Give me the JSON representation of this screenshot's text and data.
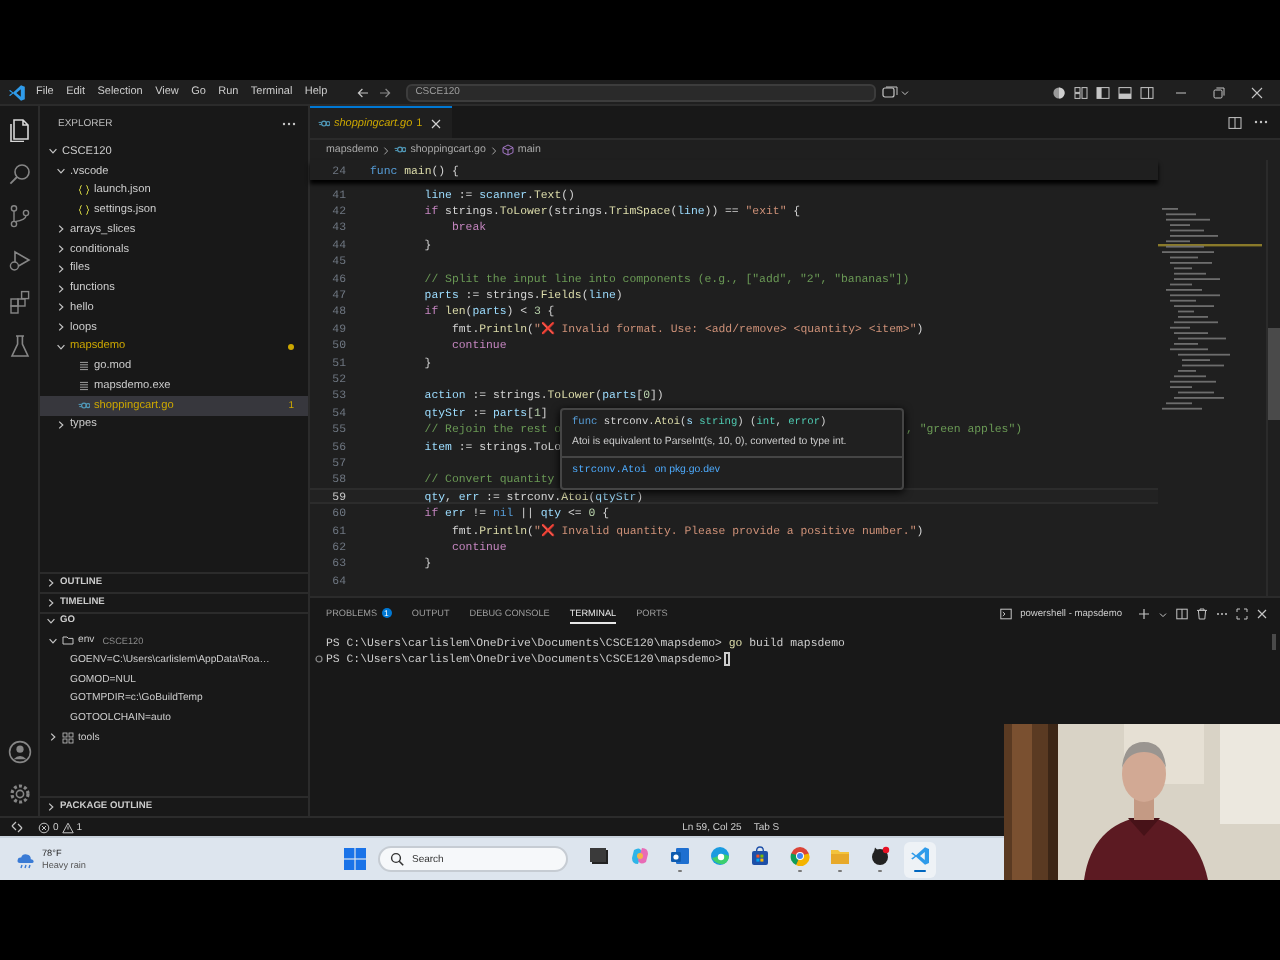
{
  "title_bar": {
    "menu": [
      "File",
      "Edit",
      "Selection",
      "View",
      "Go",
      "Run",
      "Terminal",
      "Help"
    ],
    "search": "CSCE120"
  },
  "activity_bar": [
    {
      "kind": "files",
      "selected": true
    },
    {
      "kind": "search",
      "selected": false
    },
    {
      "kind": "scm",
      "selected": false
    },
    {
      "kind": "debug",
      "selected": false
    },
    {
      "kind": "extensions",
      "selected": false
    },
    {
      "kind": "testing",
      "selected": false
    },
    {
      "kind": "account",
      "selected": false
    },
    {
      "kind": "settings",
      "selected": false
    }
  ],
  "sidebar": {
    "title": "EXPLORER",
    "tree": [
      {
        "label": "CSCE120",
        "kind": "folder",
        "expanded": true,
        "selected": false,
        "warning": false,
        "children": [
          {
            "label": ".vscode",
            "kind": "folder",
            "expanded": true,
            "selected": false,
            "warning": false,
            "children": [
              {
                "label": "launch.json",
                "kind": "json",
                "selected": false,
                "warning": false
              },
              {
                "label": "settings.json",
                "kind": "json",
                "selected": false,
                "warning": false
              }
            ]
          },
          {
            "label": "arrays_slices",
            "kind": "folder",
            "expanded": false,
            "selected": false,
            "warning": false
          },
          {
            "label": "conditionals",
            "kind": "folder",
            "expanded": false,
            "selected": false,
            "warning": false
          },
          {
            "label": "files",
            "kind": "folder",
            "expanded": false,
            "selected": false,
            "warning": false
          },
          {
            "label": "functions",
            "kind": "folder",
            "expanded": false,
            "selected": false,
            "warning": false
          },
          {
            "label": "hello",
            "kind": "folder",
            "expanded": false,
            "selected": false,
            "warning": false
          },
          {
            "label": "loops",
            "kind": "folder",
            "expanded": false,
            "selected": false,
            "warning": false
          },
          {
            "label": "mapsdemo",
            "kind": "folder",
            "expanded": true,
            "selected": false,
            "warning": true,
            "children": [
              {
                "label": "go.mod",
                "kind": "file",
                "selected": false,
                "warning": false
              },
              {
                "label": "mapsdemo.exe",
                "kind": "file",
                "selected": false,
                "warning": false
              },
              {
                "label": "shoppingcart.go",
                "kind": "go",
                "selected": true,
                "warning": true,
                "badge": "1"
              }
            ]
          },
          {
            "label": "types",
            "kind": "folder",
            "expanded": false,
            "selected": false,
            "warning": false
          }
        ]
      }
    ],
    "sections": [
      {
        "label": "OUTLINE",
        "expanded": false
      },
      {
        "label": "TIMELINE",
        "expanded": false
      },
      {
        "label": "GO",
        "expanded": true,
        "tree": [
          {
            "label": "env",
            "detail": "CSCE120",
            "kind": "folder",
            "expanded": true,
            "children": [
              {
                "label": "GOENV=C:\\Users\\carlislem\\AppData\\Roa…"
              },
              {
                "label": "GOMOD=NUL"
              },
              {
                "label": "GOTMPDIR=c:\\GoBuildTemp"
              },
              {
                "label": "GOTOOLCHAIN=auto"
              }
            ]
          },
          {
            "label": "tools",
            "kind": "tools",
            "expanded": false
          }
        ]
      },
      {
        "label": "PACKAGE OUTLINE",
        "expanded": false
      }
    ]
  },
  "editor": {
    "tabs": [
      {
        "label": "shoppingcart.go",
        "badge": "1",
        "selected": true,
        "warning": true
      }
    ],
    "breadcrumbs": [
      {
        "label": "mapsdemo",
        "kind": "folder"
      },
      {
        "label": "shoppingcart.go",
        "kind": "go"
      },
      {
        "label": "main",
        "kind": "function"
      }
    ],
    "sticky": {
      "n": "24",
      "code": [
        {
          "kind": "keyword",
          "text": "func "
        },
        {
          "kind": "function",
          "text": "main"
        },
        {
          "kind": "plain",
          "text": "() {"
        }
      ]
    },
    "lines": [
      {
        "n": "41",
        "current": false,
        "code": [
          {
            "kind": "variable",
            "text": "        line"
          },
          {
            "kind": "plain",
            "text": " := "
          },
          {
            "kind": "variable",
            "text": "scanner"
          },
          {
            "kind": "plain",
            "text": "."
          },
          {
            "kind": "function",
            "text": "Text"
          },
          {
            "kind": "plain",
            "text": "()"
          }
        ]
      },
      {
        "n": "42",
        "current": false,
        "code": [
          {
            "kind": "control",
            "text": "        if"
          },
          {
            "kind": "plain",
            "text": " strings."
          },
          {
            "kind": "function",
            "text": "ToLower"
          },
          {
            "kind": "plain",
            "text": "(strings."
          },
          {
            "kind": "function",
            "text": "TrimSpace"
          },
          {
            "kind": "plain",
            "text": "("
          },
          {
            "kind": "variable",
            "text": "line"
          },
          {
            "kind": "plain",
            "text": ")) == "
          },
          {
            "kind": "string",
            "text": "\"exit\""
          },
          {
            "kind": "plain",
            "text": " {"
          }
        ]
      },
      {
        "n": "43",
        "current": false,
        "code": [
          {
            "kind": "control",
            "text": "            break"
          }
        ]
      },
      {
        "n": "44",
        "current": false,
        "code": [
          {
            "kind": "plain",
            "text": "        }"
          }
        ]
      },
      {
        "n": "45",
        "current": false
      },
      {
        "n": "46",
        "current": false,
        "code": [
          {
            "kind": "comment",
            "text": "        // Split the input line into components (e.g., [\"add\", \"2\", \"bananas\"])"
          }
        ]
      },
      {
        "n": "47",
        "current": false,
        "code": [
          {
            "kind": "variable",
            "text": "        parts"
          },
          {
            "kind": "plain",
            "text": " := strings."
          },
          {
            "kind": "function",
            "text": "Fields"
          },
          {
            "kind": "plain",
            "text": "("
          },
          {
            "kind": "variable",
            "text": "line"
          },
          {
            "kind": "plain",
            "text": ")"
          }
        ]
      },
      {
        "n": "48",
        "current": false,
        "code": [
          {
            "kind": "control",
            "text": "        if "
          },
          {
            "kind": "function",
            "text": "len"
          },
          {
            "kind": "plain",
            "text": "("
          },
          {
            "kind": "variable",
            "text": "parts"
          },
          {
            "kind": "plain",
            "text": ") < "
          },
          {
            "kind": "number",
            "text": "3"
          },
          {
            "kind": "plain",
            "text": " {"
          }
        ]
      },
      {
        "n": "49",
        "current": false,
        "code": [
          {
            "kind": "plain",
            "text": "            fmt."
          },
          {
            "kind": "function",
            "text": "Println"
          },
          {
            "kind": "plain",
            "text": "("
          },
          {
            "kind": "string",
            "text": "\"❌ Invalid format. Use: <add/remove> <quantity> <item>\""
          },
          {
            "kind": "plain",
            "text": ")"
          }
        ]
      },
      {
        "n": "50",
        "current": false,
        "code": [
          {
            "kind": "control",
            "text": "            continue"
          }
        ]
      },
      {
        "n": "51",
        "current": false,
        "code": [
          {
            "kind": "plain",
            "text": "        }"
          }
        ]
      },
      {
        "n": "52",
        "current": false
      },
      {
        "n": "53",
        "current": false,
        "code": [
          {
            "kind": "variable",
            "text": "        action"
          },
          {
            "kind": "plain",
            "text": " := strings."
          },
          {
            "kind": "function",
            "text": "ToLower"
          },
          {
            "kind": "plain",
            "text": "("
          },
          {
            "kind": "variable",
            "text": "parts"
          },
          {
            "kind": "plain",
            "text": "["
          },
          {
            "kind": "number",
            "text": "0"
          },
          {
            "kind": "plain",
            "text": "])"
          }
        ]
      },
      {
        "n": "54",
        "current": false,
        "code": [
          {
            "kind": "variable",
            "text": "        qtyStr"
          },
          {
            "kind": "plain",
            "text": " := "
          },
          {
            "kind": "variable",
            "text": "parts"
          },
          {
            "kind": "plain",
            "text": "["
          },
          {
            "kind": "number",
            "text": "1"
          },
          {
            "kind": "plain",
            "text": "]"
          }
        ]
      },
      {
        "n": "55",
        "current": false,
        "code": [
          {
            "kind": "comment",
            "text": "        // Rejoin the rest o"
          }
        ],
        "tail": [
          {
            "kind": "comment",
            "text": ", \"green apples\")"
          }
        ]
      },
      {
        "n": "56",
        "current": false,
        "code": [
          {
            "kind": "variable",
            "text": "        item"
          },
          {
            "kind": "plain",
            "text": " := strings.ToLo"
          }
        ]
      },
      {
        "n": "57",
        "current": false
      },
      {
        "n": "58",
        "current": false,
        "code": [
          {
            "kind": "comment",
            "text": "        // Convert quantity"
          }
        ]
      },
      {
        "n": "59",
        "current": true,
        "code": [
          {
            "kind": "variable",
            "text": "        qty"
          },
          {
            "kind": "plain",
            "text": ", "
          },
          {
            "kind": "variable",
            "text": "err"
          },
          {
            "kind": "plain",
            "text": " := strconv."
          },
          {
            "kind": "function",
            "text": "Atoi"
          },
          {
            "kind": "plain",
            "text": "("
          },
          {
            "kind": "variable",
            "text": "qtyStr"
          },
          {
            "kind": "plain",
            "text": ")"
          }
        ]
      },
      {
        "n": "60",
        "current": false,
        "code": [
          {
            "kind": "control",
            "text": "        if "
          },
          {
            "kind": "variable",
            "text": "err"
          },
          {
            "kind": "plain",
            "text": " != "
          },
          {
            "kind": "keyword",
            "text": "nil"
          },
          {
            "kind": "plain",
            "text": " || "
          },
          {
            "kind": "variable",
            "text": "qty"
          },
          {
            "kind": "plain",
            "text": " <= "
          },
          {
            "kind": "number",
            "text": "0"
          },
          {
            "kind": "plain",
            "text": " {"
          }
        ]
      },
      {
        "n": "61",
        "current": false,
        "code": [
          {
            "kind": "plain",
            "text": "            fmt."
          },
          {
            "kind": "function",
            "text": "Println"
          },
          {
            "kind": "plain",
            "text": "("
          },
          {
            "kind": "string",
            "text": "\"❌ Invalid quantity. Please provide a positive number.\""
          },
          {
            "kind": "plain",
            "text": ")"
          }
        ]
      },
      {
        "n": "62",
        "current": false,
        "code": [
          {
            "kind": "control",
            "text": "            continue"
          }
        ]
      },
      {
        "n": "63",
        "current": false,
        "code": [
          {
            "kind": "plain",
            "text": "        }"
          }
        ]
      },
      {
        "n": "64",
        "current": false
      }
    ],
    "hover": {
      "signature": [
        {
          "kind": "keyword",
          "text": "func"
        },
        {
          "kind": "plain",
          "text": " strconv."
        },
        {
          "kind": "function",
          "text": "Atoi"
        },
        {
          "kind": "plain",
          "text": "("
        },
        {
          "kind": "variable",
          "text": "s "
        },
        {
          "kind": "type",
          "text": "string"
        },
        {
          "kind": "plain",
          "text": ") ("
        },
        {
          "kind": "type",
          "text": "int"
        },
        {
          "kind": "plain",
          "text": ", "
        },
        {
          "kind": "type",
          "text": "error"
        },
        {
          "kind": "plain",
          "text": ")"
        }
      ],
      "doc": "Atoi is equivalent to ParseInt(s, 10, 0), converted to type int.",
      "links": [
        "strconv.Atoi",
        "on pkg.go.dev"
      ]
    }
  },
  "panel": {
    "tabs": [
      {
        "label": "PROBLEMS",
        "badge": "1",
        "selected": false
      },
      {
        "label": "OUTPUT",
        "selected": false
      },
      {
        "label": "DEBUG CONSOLE",
        "selected": false
      },
      {
        "label": "TERMINAL",
        "selected": true
      },
      {
        "label": "PORTS",
        "selected": false
      }
    ],
    "terminal_name": "powershell - mapsdemo",
    "lines": [
      {
        "prompt": "PS C:\\Users\\carlislem\\OneDrive\\Documents\\CSCE120\\mapsdemo>",
        "command": [
          {
            "kind": "function",
            "text": "go"
          },
          {
            "kind": "shell",
            "text": " build mapsdemo"
          }
        ],
        "decoration": false,
        "cursor": false
      },
      {
        "prompt": "PS C:\\Users\\carlislem\\OneDrive\\Documents\\CSCE120\\mapsdemo>",
        "decoration": true,
        "cursor": true
      }
    ]
  },
  "status_bar": {
    "errors": "0",
    "warnings": "1",
    "position": "Ln 59, Col 25",
    "indent": "Tab S"
  },
  "taskbar": {
    "weather": {
      "temp": "78°F",
      "desc": "Heavy rain"
    },
    "search": {
      "placeholder": "Search"
    },
    "apps": [
      {
        "kind": "taskview",
        "running": false,
        "selected": false
      },
      {
        "kind": "copilot",
        "running": false,
        "selected": false
      },
      {
        "kind": "mail",
        "running": true,
        "selected": false
      },
      {
        "kind": "browser",
        "running": false,
        "selected": false
      },
      {
        "kind": "store",
        "running": false,
        "selected": false
      },
      {
        "kind": "chrome",
        "running": true,
        "selected": false
      },
      {
        "kind": "folder",
        "running": true,
        "selected": false
      },
      {
        "kind": "github",
        "running": true,
        "selected": false
      },
      {
        "kind": "vscode",
        "running": true,
        "selected": true
      }
    ]
  }
}
